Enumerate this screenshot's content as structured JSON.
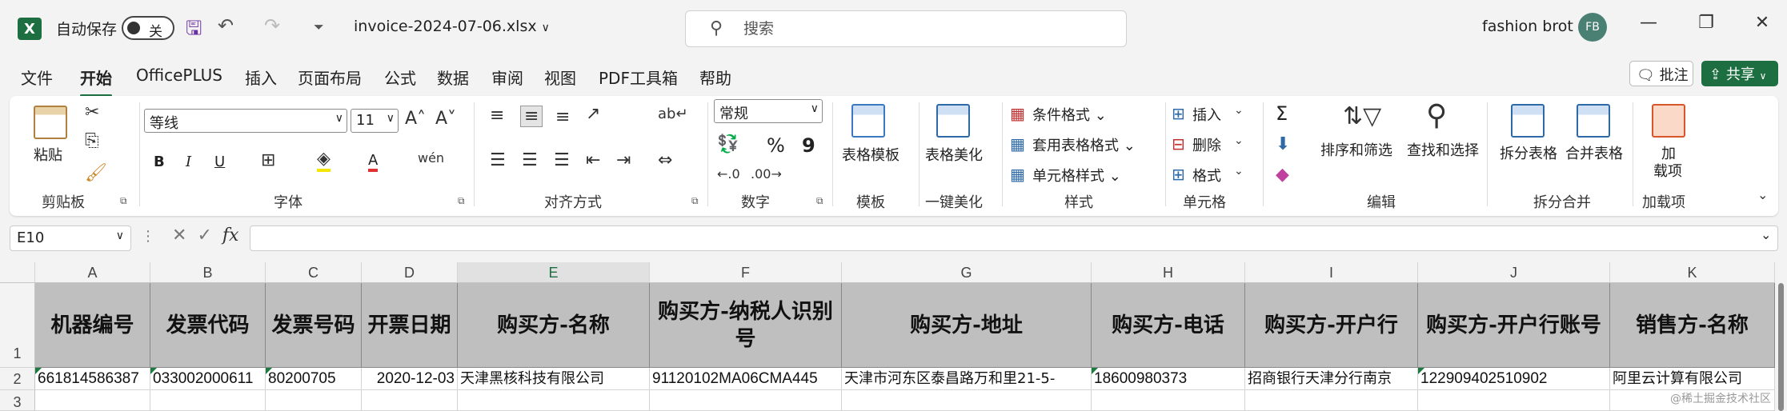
{
  "titlebar": {
    "autosave_label": "自动保存",
    "autosave_state": "关",
    "filename": "invoice-2024-07-06.xlsx",
    "search_placeholder": "搜索",
    "username": "fashion brot",
    "avatar_initials": "FB"
  },
  "menu": {
    "items": [
      "文件",
      "开始",
      "OfficePLUS",
      "插入",
      "页面布局",
      "公式",
      "数据",
      "审阅",
      "视图",
      "PDF工具箱",
      "帮助"
    ],
    "active": "开始",
    "comment_label": "批注",
    "share_label": "共享"
  },
  "ribbon": {
    "clipboard": {
      "paste": "粘贴",
      "label": "剪贴板"
    },
    "font": {
      "name": "等线",
      "size": "11",
      "label": "字体",
      "bold": "B",
      "italic": "I",
      "underline": "U",
      "font_color": "A"
    },
    "align": {
      "label": "对齐方式"
    },
    "number": {
      "format": "常规",
      "label": "数字",
      "percent": "%",
      "comma": "9"
    },
    "template": {
      "button": "表格模板",
      "label": "模板"
    },
    "beautify": {
      "button": "表格美化",
      "label": "一键美化"
    },
    "styles": {
      "conditional": "条件格式",
      "table": "套用表格格式",
      "cell": "单元格样式",
      "label": "样式"
    },
    "cells": {
      "insert": "插入",
      "delete": "删除",
      "format": "格式",
      "label": "单元格"
    },
    "edit": {
      "sum": "Σ",
      "sort": "排序和筛选",
      "find": "查找和选择",
      "label": "编辑"
    },
    "split": {
      "split": "拆分表格",
      "merge": "合并表格",
      "label": "拆分合并"
    },
    "addins": {
      "button_line1": "加",
      "button_line2": "载项",
      "label": "加载项"
    }
  },
  "formula_bar": {
    "namebox": "E10",
    "fx": "fx",
    "value": ""
  },
  "grid": {
    "columns": [
      "A",
      "B",
      "C",
      "D",
      "E",
      "F",
      "G",
      "H",
      "I",
      "J",
      "K"
    ],
    "selected_column": "E",
    "rows": [
      "1",
      "2",
      "3"
    ],
    "header_row": [
      "机器编号",
      "发票代码",
      "发票号码",
      "开票日期",
      "购买方-名称",
      "购买方-纳税人识别号",
      "购买方-地址",
      "购买方-电话",
      "购买方-开户行",
      "购买方-开户行账号",
      "销售方-名称"
    ],
    "data_row": [
      "661814586387",
      "033002000611",
      "80200705",
      "2020-12-03",
      "天津黑核科技有限公司",
      "91120102MA06CMA445",
      "天津市河东区泰昌路万和里21-5-",
      "18600980373",
      "招商银行天津分行南京",
      "122909402510902",
      "阿里云计算有限公司"
    ]
  },
  "watermark": "@稀土掘金技术社区",
  "colors": {
    "accent": "#1d6f42",
    "header_fill": "#bfbfbf"
  }
}
